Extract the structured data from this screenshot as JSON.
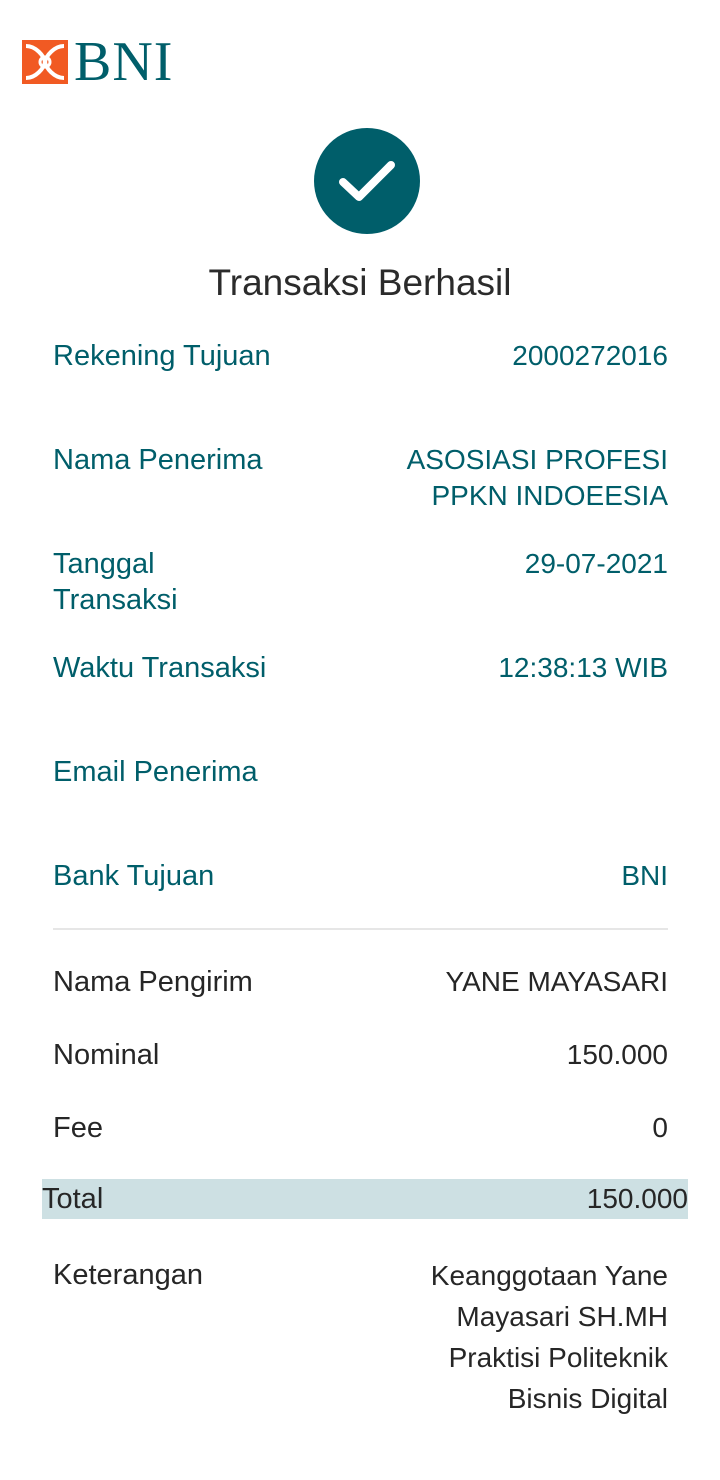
{
  "logo": {
    "text": "BNI",
    "brand_color": "#F15A23",
    "text_color": "#005E6A"
  },
  "status": {
    "icon": "check-icon",
    "title": "Transaksi Berhasil"
  },
  "details": {
    "rekening_label": "Rekening Tujuan",
    "rekening_value": "2000272016",
    "nama_label": "Nama Penerima",
    "nama_value": "ASOSIASI PROFESI PPKN INDOEESIA",
    "tanggal_label": "Tanggal Transaksi",
    "tanggal_value": "29-07-2021",
    "waktu_label": "Waktu Transaksi",
    "waktu_value": "12:38:13 WIB",
    "email_label": "Email Penerima",
    "email_value": "",
    "bank_label": "Bank Tujuan",
    "bank_value": "BNI"
  },
  "summary": {
    "pengirim_label": "Nama Pengirim",
    "pengirim_value": "YANE MAYASARI",
    "nominal_label": "Nominal",
    "nominal_value": "150.000",
    "fee_label": "Fee",
    "fee_value": "0",
    "total_label": "Total",
    "total_value": "150.000",
    "keterangan_label": "Keterangan",
    "keterangan_value": "Keanggotaan Yane Mayasari SH.MH Praktisi Politeknik Bisnis Digital"
  },
  "colors": {
    "accent": "#005E6A",
    "highlight": "#CDE0E3"
  }
}
